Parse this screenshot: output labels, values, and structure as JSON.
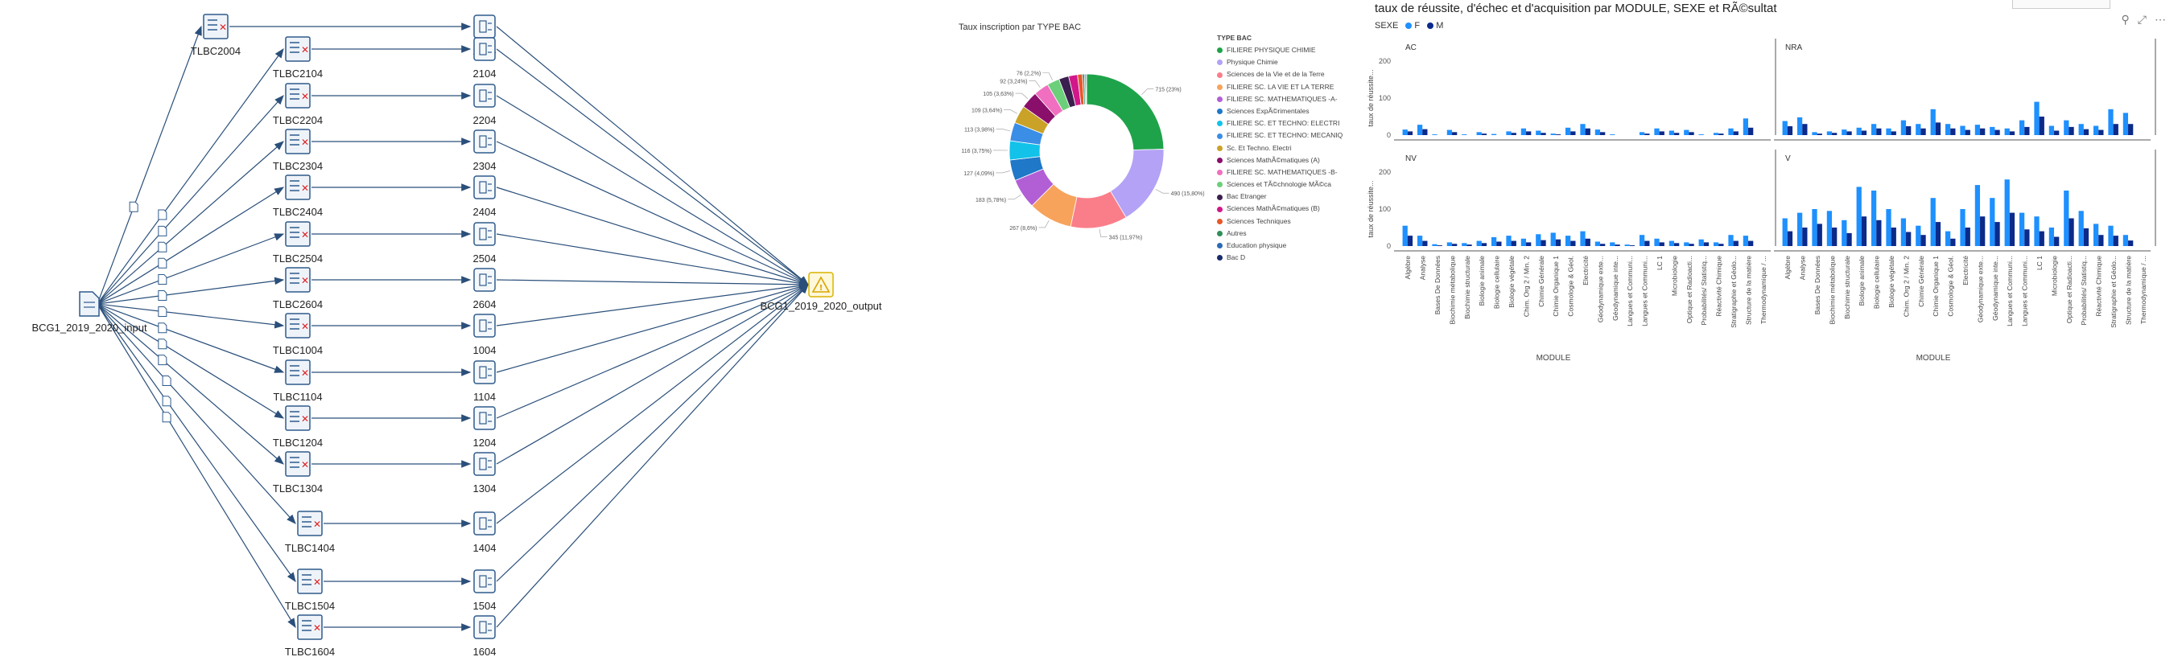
{
  "flow": {
    "input_label": "BCG1_2019_2020_input",
    "output_label": "BCG1_2019_2020_output",
    "rows": [
      {
        "src": "TLBC2004",
        "tgt": "2004"
      },
      {
        "src": "TLBC2104",
        "tgt": "2104"
      },
      {
        "src": "TLBC2204",
        "tgt": "2204"
      },
      {
        "src": "TLBC2304",
        "tgt": "2304"
      },
      {
        "src": "TLBC2404",
        "tgt": "2404"
      },
      {
        "src": "TLBC2504",
        "tgt": "2504"
      },
      {
        "src": "TLBC2604",
        "tgt": "2604"
      },
      {
        "src": "TLBC1004",
        "tgt": "1004"
      },
      {
        "src": "TLBC1104",
        "tgt": "1104"
      },
      {
        "src": "TLBC1204",
        "tgt": "1204"
      },
      {
        "src": "TLBC1304",
        "tgt": "1304"
      },
      {
        "src": "TLBC1404",
        "tgt": "1404"
      },
      {
        "src": "TLBC1504",
        "tgt": "1504"
      },
      {
        "src": "TLBC1604",
        "tgt": "1604"
      }
    ]
  },
  "donut": {
    "title": "Taux inscription par TYPE BAC",
    "legend_title": "TYPE BAC",
    "chart_data": {
      "type": "pie",
      "slices": [
        {
          "label": "FILIERE PHYSIQUE CHIMIE",
          "value": 715,
          "text": "715 (23%)",
          "color": "#1fa34a"
        },
        {
          "label": "Physique Chimie",
          "value": 490,
          "text": "490 (15,80%)",
          "color": "#b3a2f5"
        },
        {
          "label": "Sciences de la Vie et de la Terre",
          "value": 345,
          "text": "345 (11,97%)",
          "color": "#fa7e8a"
        },
        {
          "label": "FILIERE SC. LA VIE ET LA TERRE",
          "value": 267,
          "text": "267 (8,6%)",
          "color": "#f7a35c"
        },
        {
          "label": "FILIERE SC. MATHEMATIQUES -A-",
          "value": 183,
          "text": "183 (5,78%)",
          "color": "#b25fd6"
        },
        {
          "label": "Sciences ExpÃ©rimentales",
          "value": 127,
          "text": "127 (4,09%)",
          "color": "#1f78c8"
        },
        {
          "label": "FILIERE SC. ET TECHNO: ELECTRI",
          "value": 116,
          "text": "116 (3,75%)",
          "color": "#12c2e9"
        },
        {
          "label": "FILIERE SC. ET TECHNO: MECANIQ",
          "value": 113,
          "text": "113 (3,98%)",
          "color": "#3a8ee6"
        },
        {
          "label": "Sc. Et Techno. Electri",
          "value": 109,
          "text": "109 (3,64%)",
          "color": "#c9a227"
        },
        {
          "label": "Sciences MathÃ©matiques (A)",
          "value": 105,
          "text": "105 (3,63%)",
          "color": "#8a0f6b"
        },
        {
          "label": "FILIERE SC. MATHEMATIQUES -B-",
          "value": 92,
          "text": "92 (3,24%)",
          "color": "#f06fc0"
        },
        {
          "label": "Sciences et TÃ©chnologie MÃ©ca",
          "value": 76,
          "text": "76 (2,2%)",
          "color": "#6ccf7a"
        },
        {
          "label": "Bac Etranger",
          "value": 60,
          "text": "",
          "color": "#3b1f4f"
        },
        {
          "label": "Sciences MathÃ©matiques (B)",
          "value": 54,
          "text": "",
          "color": "#d1178a"
        },
        {
          "label": "Sciences Techniques",
          "value": 30,
          "text": "",
          "color": "#e8572a"
        },
        {
          "label": "Autres",
          "value": 12,
          "text": "",
          "color": "#2f8f5a"
        },
        {
          "label": "Education physique",
          "value": 8,
          "text": "",
          "color": "#2b6bb5"
        },
        {
          "label": "Bac D",
          "value": 5,
          "text": "",
          "color": "#1b2a6b"
        }
      ]
    }
  },
  "bars": {
    "title": "taux de réussite, d'échec et d'acquisition par MODULE, SEXE et RÃ©sultat",
    "legend_label": "SEXE",
    "legend_items": [
      {
        "name": "F",
        "color": "#1e90ff"
      },
      {
        "name": "M",
        "color": "#0b2a8a"
      }
    ],
    "y_axis_label": "taux de réussite...",
    "x_axis_label": "MODULE",
    "y_ticks": [
      "0",
      "100",
      "200"
    ],
    "chart_data": {
      "type": "bar",
      "ylim": [
        0,
        200
      ],
      "panels": [
        {
          "name": "AC",
          "categories": [
            "Algèbre",
            "Analyse",
            "Bases De Données",
            "Biochimie métabolique",
            "Biochimie structurale",
            "Biologie animale",
            "Biologie cellulaire",
            "Biologie végétale",
            "Chim. Org 2 / Min. 2",
            "Chimie Générale",
            "Chimie Organique 1",
            "Cosmologie & Géol.",
            "Electricité",
            "Géodynamique exte...",
            "Géodynamique inte...",
            "Langues et Communi...",
            "Langues et Communi...",
            "LC 1",
            "Microbiologie",
            "Optique et Radioacti...",
            "Probabilités/ Statistiq...",
            "Réactivité Chimique",
            "Stratigraphie et Géolo...",
            "Structure de la matière",
            "Thermodynamique / ..."
          ],
          "series": [
            {
              "name": "F",
              "values": [
                15,
                28,
                2,
                14,
                2,
                8,
                3,
                10,
                18,
                12,
                4,
                20,
                30,
                15,
                2,
                0,
                8,
                18,
                12,
                14,
                2,
                6,
                18,
                45,
                0
              ]
            },
            {
              "name": "M",
              "values": [
                10,
                16,
                0,
                8,
                0,
                4,
                0,
                6,
                10,
                6,
                2,
                10,
                18,
                8,
                0,
                0,
                4,
                10,
                6,
                8,
                0,
                4,
                10,
                20,
                0
              ]
            }
          ]
        },
        {
          "name": "NRA",
          "categories": [
            "Algèbre",
            "Analyse",
            "Bases De Données",
            "Biochimie métabolique",
            "Biochimie structurale",
            "Biologie animale",
            "Biologie cellulaire",
            "Biologie végétale",
            "Chim. Org 2 / Min. 2",
            "Chimie Générale",
            "Chimie Organique 1",
            "Cosmologie & Géol.",
            "Electricité",
            "Géodynamique exte...",
            "Géodynamique inte...",
            "Langues et Communi...",
            "Langues et Communi...",
            "LC 1",
            "Microbiologie",
            "Optique et Radioacti...",
            "Probabilités/ Statistiq...",
            "Réactivité Chimique",
            "Stratigraphie et Géolo...",
            "Structure de la matière",
            "Thermodynamique / ..."
          ],
          "series": [
            {
              "name": "F",
              "values": [
                38,
                48,
                8,
                10,
                15,
                20,
                30,
                18,
                40,
                30,
                70,
                30,
                25,
                28,
                22,
                18,
                40,
                90,
                25,
                40,
                30,
                25,
                70,
                60,
                0
              ]
            },
            {
              "name": "M",
              "values": [
                24,
                30,
                4,
                6,
                10,
                12,
                18,
                10,
                24,
                18,
                34,
                18,
                14,
                18,
                14,
                10,
                22,
                50,
                12,
                22,
                16,
                14,
                30,
                30,
                0
              ]
            }
          ]
        },
        {
          "name": "NV",
          "categories": [
            "Algèbre",
            "Analyse",
            "Bases De Données",
            "Biochimie métabolique",
            "Biochimie structurale",
            "Biologie animale",
            "Biologie cellulaire",
            "Biologie végétale",
            "Chim. Org 2 / Min. 2",
            "Chimie Générale",
            "Chimie Organique 1",
            "Cosmologie & Géol.",
            "Electricité",
            "Géodynamique exte...",
            "Géodynamique inte...",
            "Langues et Communi...",
            "Langues et Communi...",
            "LC 1",
            "Microbiologie",
            "Optique et Radioacti...",
            "Probabilités/ Statistiq...",
            "Réactivité Chimique",
            "Stratigraphie et Géolo...",
            "Structure de la matière",
            "Thermodynamique / ..."
          ],
          "series": [
            {
              "name": "F",
              "values": [
                55,
                28,
                5,
                10,
                8,
                14,
                24,
                28,
                20,
                32,
                36,
                28,
                40,
                12,
                10,
                4,
                30,
                20,
                14,
                10,
                18,
                10,
                30,
                28,
                0
              ]
            },
            {
              "name": "M",
              "values": [
                28,
                14,
                2,
                6,
                4,
                8,
                12,
                14,
                10,
                16,
                18,
                14,
                20,
                6,
                4,
                2,
                14,
                10,
                8,
                6,
                10,
                6,
                14,
                14,
                0
              ]
            }
          ]
        },
        {
          "name": "V",
          "categories": [
            "Algèbre",
            "Analyse",
            "Bases De Données",
            "Biochimie métabolique",
            "Biochimie structurale",
            "Biologie animale",
            "Biologie cellulaire",
            "Biologie végétale",
            "Chim. Org 2 / Min. 2",
            "Chimie Générale",
            "Chimie Organique 1",
            "Cosmologie & Géol.",
            "Electricité",
            "Géodynamique exte...",
            "Géodynamique inte...",
            "Langues et Communi...",
            "Langues et Communi...",
            "LC 1",
            "Microbiologie",
            "Optique et Radioacti...",
            "Probabilités/ Statistiq...",
            "Réactivité Chimique",
            "Stratigraphie et Géolo...",
            "Structure de la matière",
            "Thermodynamique / ..."
          ],
          "series": [
            {
              "name": "F",
              "values": [
                75,
                90,
                100,
                95,
                70,
                160,
                150,
                100,
                75,
                55,
                130,
                40,
                100,
                165,
                130,
                180,
                90,
                80,
                50,
                150,
                95,
                60,
                55,
                30,
                0
              ]
            },
            {
              "name": "M",
              "values": [
                40,
                50,
                60,
                50,
                35,
                80,
                70,
                50,
                38,
                30,
                65,
                20,
                50,
                80,
                65,
                90,
                45,
                40,
                25,
                75,
                48,
                30,
                28,
                15,
                0
              ]
            }
          ]
        }
      ]
    }
  },
  "top_icons": [
    "filter-icon",
    "focus-mode-icon",
    "more-options-icon"
  ]
}
